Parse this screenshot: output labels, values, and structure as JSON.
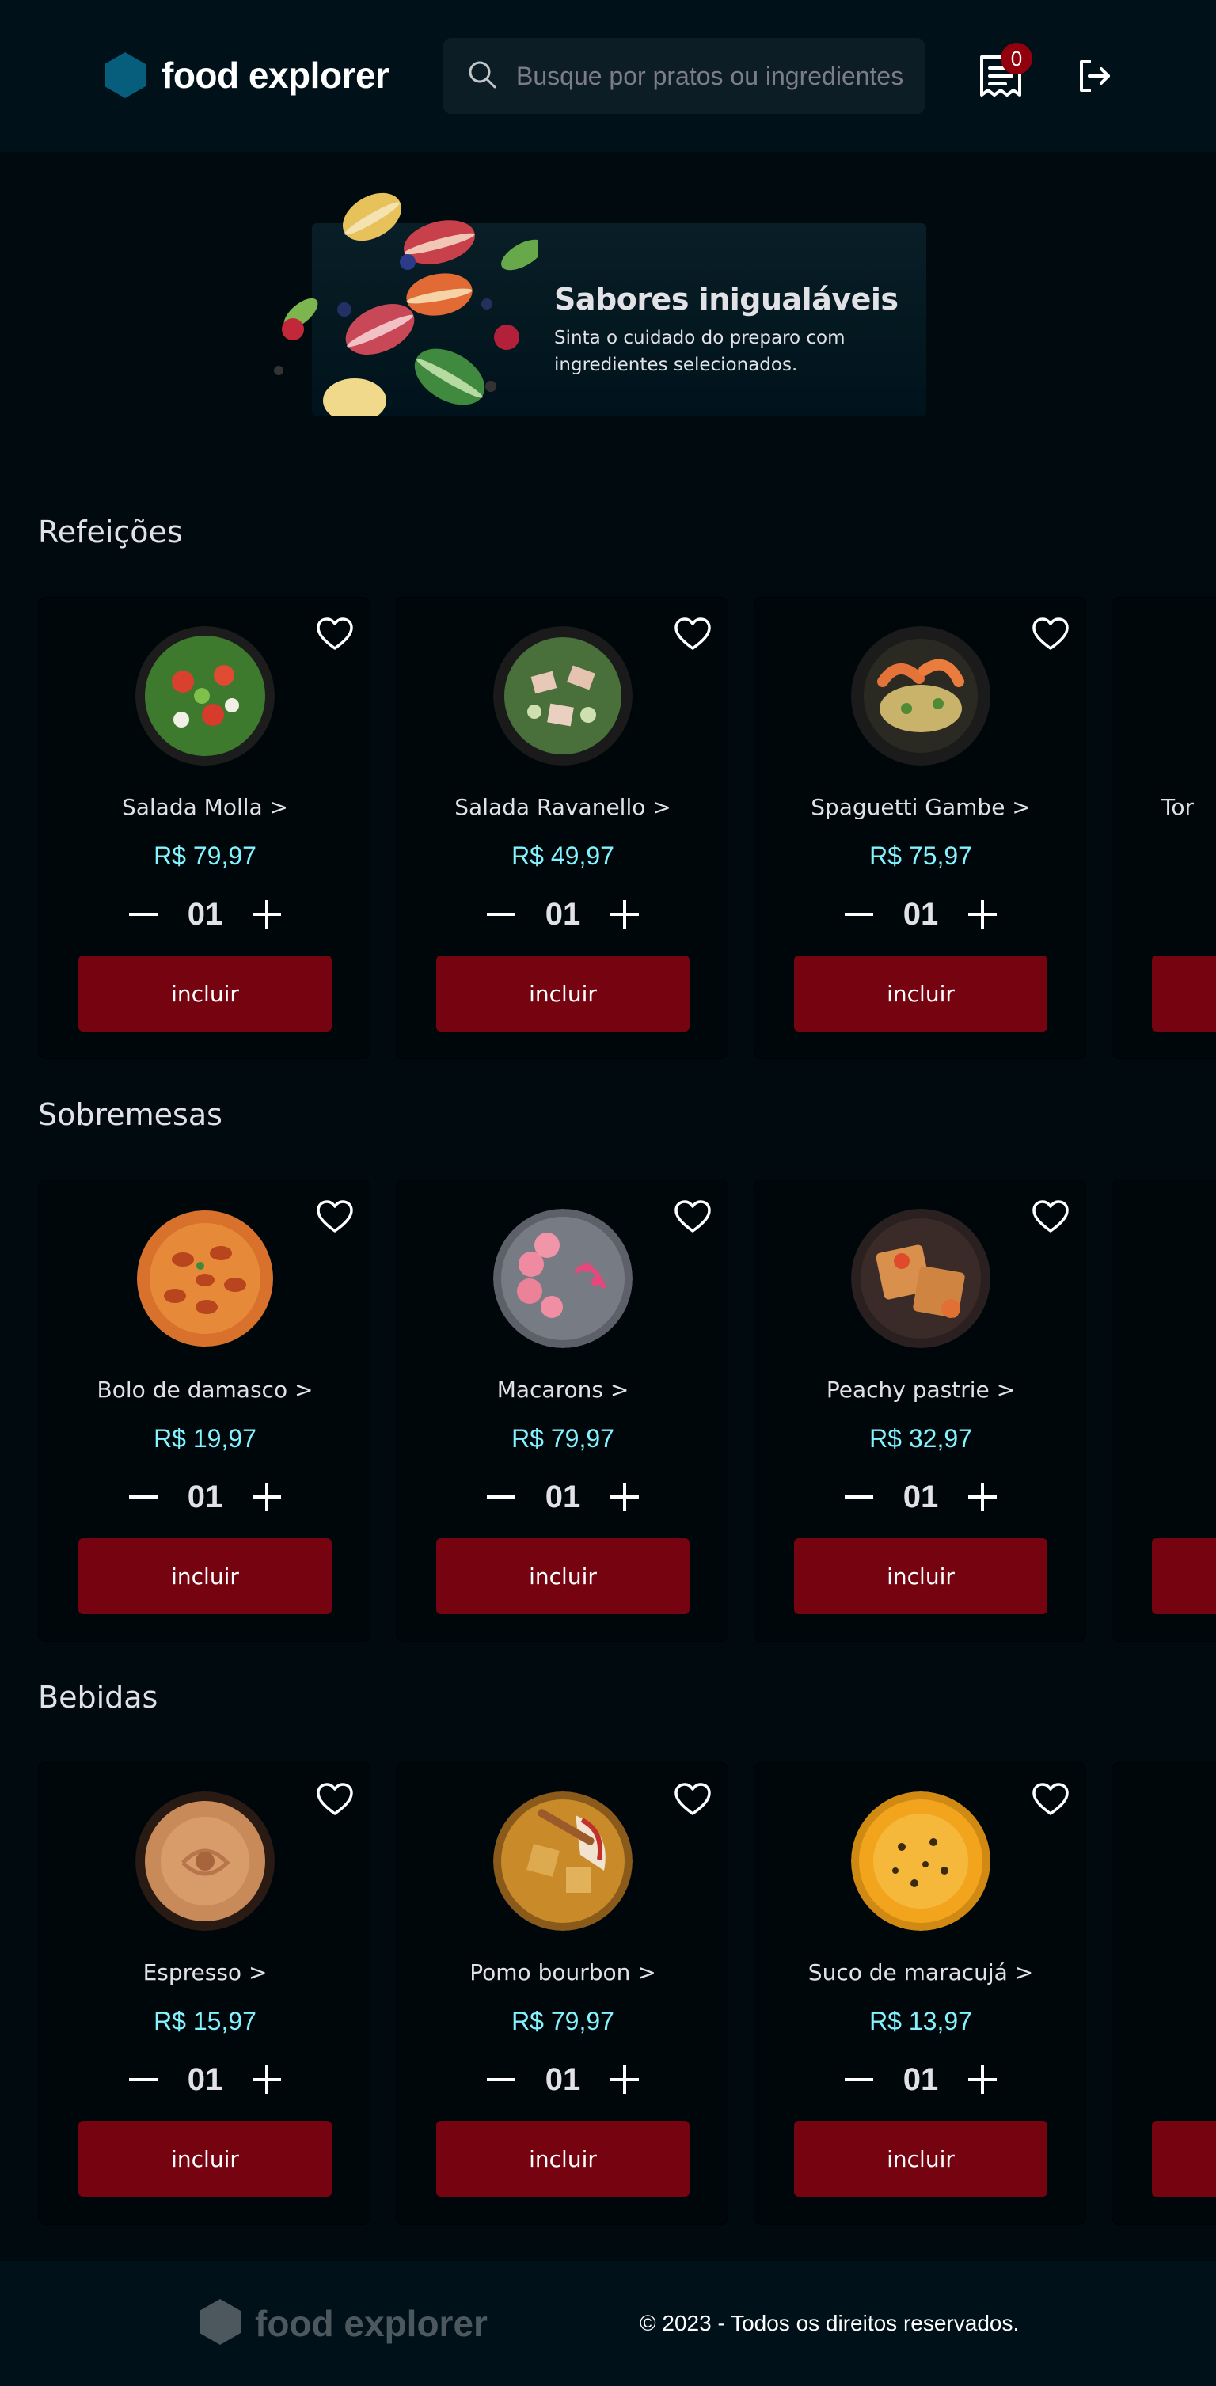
{
  "header": {
    "brand": "food explorer",
    "search_placeholder": "Busque por pratos ou ingredientes",
    "cart_count": "0"
  },
  "banner": {
    "title": "Sabores inigualáveis",
    "subtitle_line1": "Sinta o cuidado do preparo com",
    "subtitle_line2": "ingredientes selecionados."
  },
  "sections": [
    {
      "title": "Refeições",
      "items": [
        {
          "name": "Salada Molla >",
          "price": "R$ 79,97",
          "qty": "01",
          "button": "incluir"
        },
        {
          "name": "Salada Ravanello >",
          "price": "R$ 49,97",
          "qty": "01",
          "button": "incluir"
        },
        {
          "name": "Spaguetti Gambe >",
          "price": "R$ 75,97",
          "qty": "01",
          "button": "incluir"
        },
        {
          "name": "Tor",
          "price": "",
          "qty": "",
          "button": ""
        }
      ]
    },
    {
      "title": "Sobremesas",
      "items": [
        {
          "name": "Bolo de damasco >",
          "price": "R$ 19,97",
          "qty": "01",
          "button": "incluir"
        },
        {
          "name": "Macarons >",
          "price": "R$ 79,97",
          "qty": "01",
          "button": "incluir"
        },
        {
          "name": "Peachy pastrie >",
          "price": "R$ 32,97",
          "qty": "01",
          "button": "incluir"
        }
      ]
    },
    {
      "title": "Bebidas",
      "items": [
        {
          "name": "Espresso >",
          "price": "R$ 15,97",
          "qty": "01",
          "button": "incluir"
        },
        {
          "name": "Pomo bourbon >",
          "price": "R$ 79,97",
          "qty": "01",
          "button": "incluir"
        },
        {
          "name": "Suco de maracujá >",
          "price": "R$ 13,97",
          "qty": "01",
          "button": "incluir"
        }
      ]
    }
  ],
  "footer": {
    "brand": "food explorer",
    "copyright": "© 2023 - Todos os direitos reservados."
  },
  "colors": {
    "background": "#000a0f",
    "header": "#00111a",
    "accent_price": "#82f3ff",
    "button": "#750310",
    "badge": "#92000e",
    "brand_hex": "#065e7c"
  },
  "icons": [
    "hexagon-logo-icon",
    "search-icon",
    "receipt-icon",
    "logout-icon",
    "heart-icon",
    "minus-icon",
    "plus-icon"
  ]
}
